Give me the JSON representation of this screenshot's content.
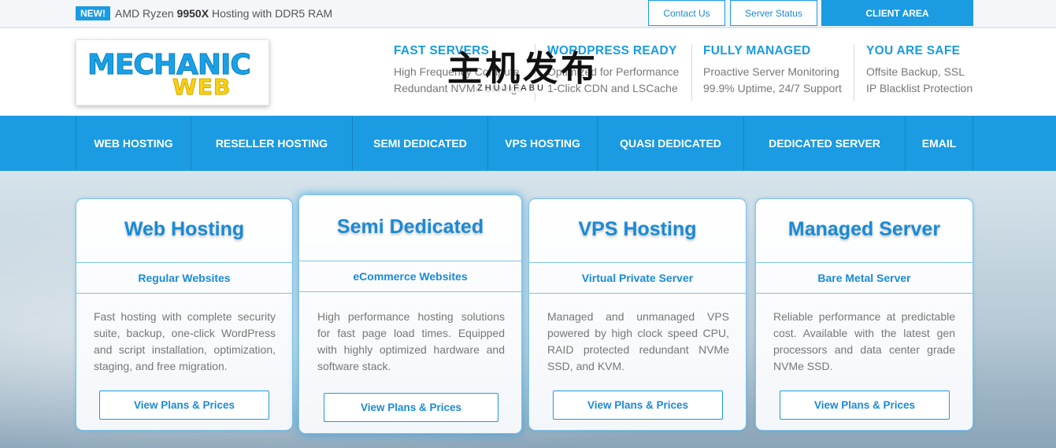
{
  "topbar": {
    "badge": "NEW!",
    "promo_prefix": "AMD Ryzen ",
    "promo_bold": "9950X",
    "promo_suffix": " Hosting with DDR5 RAM",
    "contact_label": "Contact Us",
    "status_label": "Server Status",
    "client_label": "CLIENT AREA"
  },
  "logo": {
    "top": "MECHANIC",
    "bottom": "WEB"
  },
  "watermark": {
    "cn": "主机发布",
    "en": "ZHUJIFABU"
  },
  "features": [
    {
      "title": "FAST SERVERS",
      "line1": "High Frequency Compute",
      "line2": "Redundant NVMe Storage"
    },
    {
      "title": "WORDPRESS READY",
      "line1": "Optimized for Performance",
      "line2": "1-Click CDN and LSCache"
    },
    {
      "title": "FULLY MANAGED",
      "line1": "Proactive Server Monitoring",
      "line2": "99.9% Uptime, 24/7 Support"
    },
    {
      "title": "YOU ARE SAFE",
      "line1": "Offsite Backup, SSL",
      "line2": "IP Blacklist Protection"
    }
  ],
  "nav": [
    "WEB HOSTING",
    "RESELLER HOSTING",
    "SEMI DEDICATED",
    "VPS HOSTING",
    "QUASI DEDICATED",
    "DEDICATED SERVER",
    "EMAIL"
  ],
  "cards": [
    {
      "title": "Web Hosting",
      "subtitle": "Regular Websites",
      "description": "Fast hosting with complete security suite, backup, one-click WordPress and script installation, optimization, staging, and free migration.",
      "button": "View Plans & Prices"
    },
    {
      "title": "Semi Dedicated",
      "subtitle": "eCommerce Websites",
      "description": "High performance hosting solutions for fast page load times. Equipped with highly optimized hardware and software stack.",
      "button": "View Plans & Prices"
    },
    {
      "title": "VPS Hosting",
      "subtitle": "Virtual Private Server",
      "description": "Managed and unmanaged VPS powered by high clock speed CPU, RAID protected redundant NVMe SSD, and KVM.",
      "button": "View Plans & Prices"
    },
    {
      "title": "Managed Server",
      "subtitle": "Bare Metal Server",
      "description": "Reliable performance at predictable cost. Available with the latest gen processors and data center grade NVMe SSD.",
      "button": "View Plans & Prices"
    }
  ],
  "colors": {
    "accent": "#1a9be2",
    "logo_yellow": "#f7d113"
  }
}
